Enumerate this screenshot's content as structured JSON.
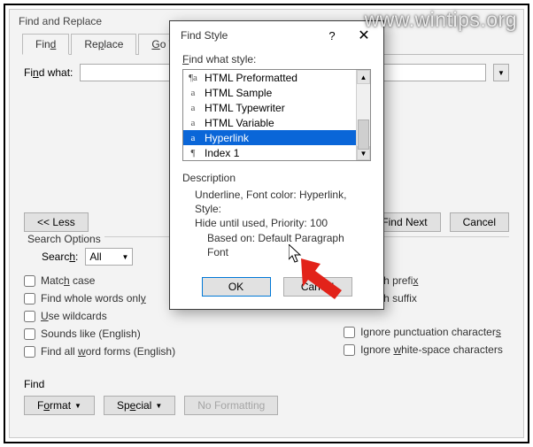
{
  "watermark": "www.wintips.org",
  "main": {
    "title": "Find and Replace",
    "tabs": {
      "find": "Find",
      "replace": "Replace",
      "goto": "Go To"
    },
    "findwhat_label": "Find what:",
    "buttons": {
      "less": "<<  Less",
      "findnext": "Find Next",
      "cancel": "Cancel"
    },
    "search_options": {
      "title": "Search Options",
      "search_label": "Search:",
      "search_value": "All",
      "left": {
        "match_case": "Match case",
        "whole_words": "Find whole words only",
        "wildcards": "Use wildcards",
        "sounds_like": "Sounds like (English)",
        "word_forms": "Find all word forms (English)"
      },
      "right": {
        "prefix": "Match prefix",
        "suffix": "Match suffix",
        "ignore_punct": "Ignore punctuation characters",
        "ignore_ws": "Ignore white-space characters"
      }
    },
    "find_section": {
      "title": "Find",
      "format": "Format",
      "special": "Special",
      "no_formatting": "No Formatting"
    }
  },
  "modal": {
    "title": "Find Style",
    "help": "?",
    "close": "✕",
    "list_label": "Find what style:",
    "items": {
      "preformatted": "HTML Preformatted",
      "sample": "HTML Sample",
      "typewriter": "HTML Typewriter",
      "variable": "HTML Variable",
      "hyperlink": "Hyperlink",
      "index1": "Index 1"
    },
    "desc_title": "Description",
    "desc_line1": "Underline, Font color: Hyperlink, Style:",
    "desc_line2": "Hide until used, Priority: 100",
    "desc_line3": "Based on: Default Paragraph Font",
    "ok": "OK",
    "cancel": "Cancel"
  }
}
